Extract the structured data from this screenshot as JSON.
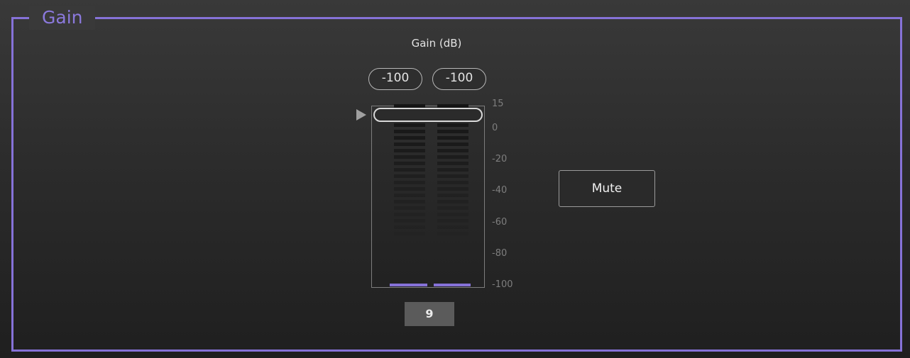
{
  "panel": {
    "title": "Gain"
  },
  "gain": {
    "title": "Gain (dB)",
    "peak_left": "-100",
    "peak_right": "-100",
    "value": "9",
    "scale_labels": [
      "15",
      "0",
      "-20",
      "-40",
      "-60",
      "-80",
      "-100"
    ],
    "range_db": [
      -100,
      15
    ],
    "fader_db": 9,
    "meter_level_left_db": -100,
    "meter_level_right_db": -100
  },
  "mute": {
    "label": "Mute"
  },
  "colors": {
    "accent": "#8672d8",
    "background": "#2c2c2c",
    "text": "#e3e3e3"
  }
}
